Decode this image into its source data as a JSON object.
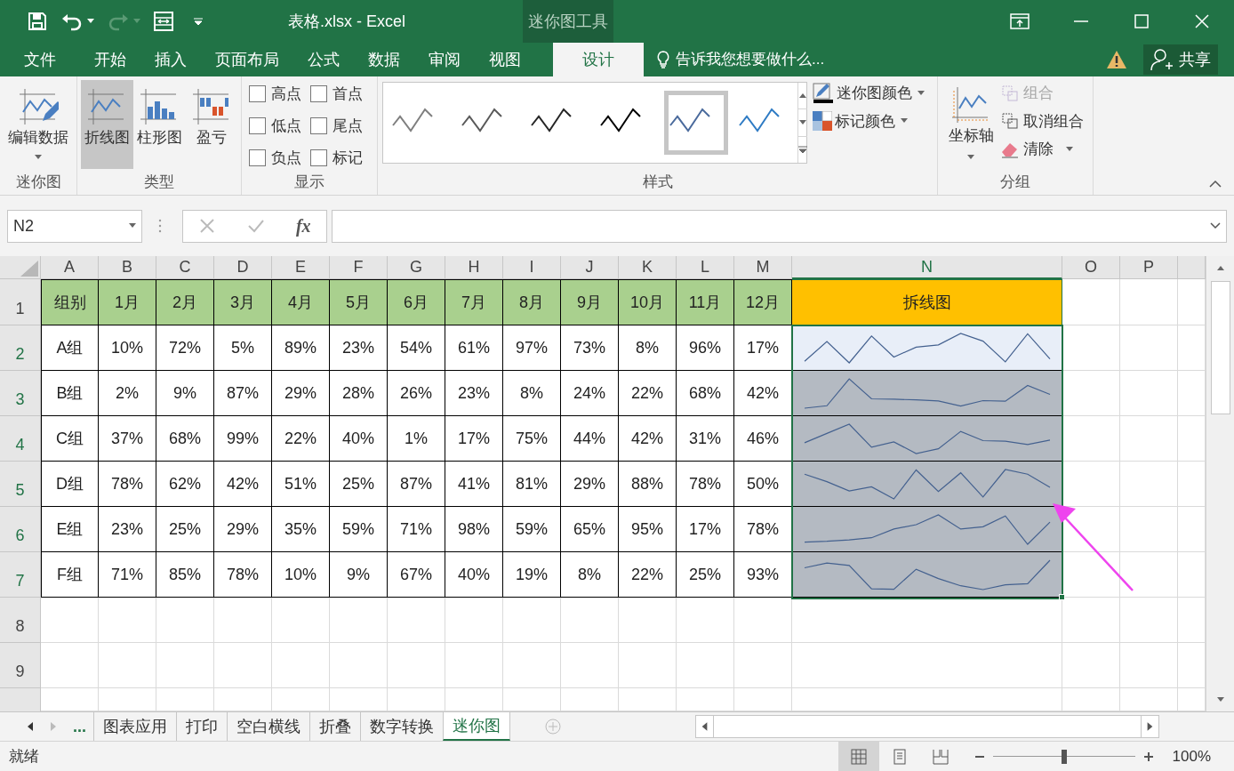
{
  "window": {
    "title": "表格.xlsx - Excel",
    "context_tab": "迷你图工具"
  },
  "ribbon_tabs": [
    {
      "label": "文件",
      "selected": false
    },
    {
      "label": "开始",
      "selected": false
    },
    {
      "label": "插入",
      "selected": false
    },
    {
      "label": "页面布局",
      "selected": false
    },
    {
      "label": "公式",
      "selected": false
    },
    {
      "label": "数据",
      "selected": false
    },
    {
      "label": "审阅",
      "selected": false
    },
    {
      "label": "视图",
      "selected": false
    },
    {
      "label": "设计",
      "selected": true
    }
  ],
  "tell_me": {
    "placeholder": "告诉我您想要做什么..."
  },
  "share": "共享",
  "ribbon": {
    "sparkline_group": {
      "label": "迷你图",
      "button": "编辑数据"
    },
    "type_group": {
      "label": "类型",
      "types": [
        {
          "label": "折线图",
          "kind": "line",
          "selected": true
        },
        {
          "label": "柱形图",
          "kind": "column",
          "selected": false
        },
        {
          "label": "盈亏",
          "kind": "winloss",
          "selected": false
        }
      ]
    },
    "show_group": {
      "label": "显示",
      "options": [
        {
          "label": "高点",
          "checked": false
        },
        {
          "label": "首点",
          "checked": false
        },
        {
          "label": "低点",
          "checked": false
        },
        {
          "label": "尾点",
          "checked": false
        },
        {
          "label": "负点",
          "checked": false
        },
        {
          "label": "标记",
          "checked": false
        }
      ]
    },
    "style_group": {
      "label": "样式",
      "styles": [
        {
          "color": "#7f7f7f",
          "selected": false
        },
        {
          "color": "#595959",
          "selected": false
        },
        {
          "color": "#262626",
          "selected": false
        },
        {
          "color": "#000000",
          "selected": false
        },
        {
          "color": "#4a6a9c",
          "selected": true
        },
        {
          "color": "#2e7bc4",
          "selected": false
        }
      ],
      "sparkline_color": "迷你图颜色",
      "marker_color": "标记颜色"
    },
    "group_group": {
      "label": "分组",
      "axis": "坐标轴",
      "group": {
        "label": "组合",
        "disabled": true
      },
      "ungroup": {
        "label": "取消组合",
        "disabled": false
      },
      "clear": "清除"
    }
  },
  "formula_bar": {
    "name_box": "N2",
    "fx": "fx"
  },
  "sheet": {
    "columns": [
      {
        "label": "A",
        "selected": false
      },
      {
        "label": "B",
        "selected": false
      },
      {
        "label": "C",
        "selected": false
      },
      {
        "label": "D",
        "selected": false
      },
      {
        "label": "E",
        "selected": false
      },
      {
        "label": "F",
        "selected": false
      },
      {
        "label": "G",
        "selected": false
      },
      {
        "label": "H",
        "selected": false
      },
      {
        "label": "I",
        "selected": false
      },
      {
        "label": "J",
        "selected": false
      },
      {
        "label": "K",
        "selected": false
      },
      {
        "label": "L",
        "selected": false
      },
      {
        "label": "M",
        "selected": false
      },
      {
        "label": "N",
        "selected": true
      },
      {
        "label": "O",
        "selected": false
      },
      {
        "label": "P",
        "selected": false
      }
    ],
    "header_row": {
      "number": "1",
      "selected": false,
      "cells": [
        "组别",
        "1月",
        "2月",
        "3月",
        "4月",
        "5月",
        "6月",
        "7月",
        "8月",
        "9月",
        "10月",
        "11月",
        "12月"
      ],
      "summary": "拆线图"
    },
    "rows": [
      {
        "number": "2",
        "selected": true,
        "active": true,
        "cells": [
          "A组",
          "10%",
          "72%",
          "5%",
          "89%",
          "23%",
          "54%",
          "61%",
          "97%",
          "73%",
          "8%",
          "96%",
          "17%"
        ]
      },
      {
        "number": "3",
        "selected": true,
        "active": false,
        "cells": [
          "B组",
          "2%",
          "9%",
          "87%",
          "29%",
          "28%",
          "26%",
          "23%",
          "8%",
          "24%",
          "22%",
          "68%",
          "42%"
        ]
      },
      {
        "number": "4",
        "selected": true,
        "active": false,
        "cells": [
          "C组",
          "37%",
          "68%",
          "99%",
          "22%",
          "40%",
          "1%",
          "17%",
          "75%",
          "44%",
          "42%",
          "31%",
          "46%"
        ]
      },
      {
        "number": "5",
        "selected": true,
        "active": false,
        "cells": [
          "D组",
          "78%",
          "62%",
          "42%",
          "51%",
          "25%",
          "87%",
          "41%",
          "81%",
          "29%",
          "88%",
          "78%",
          "50%"
        ]
      },
      {
        "number": "6",
        "selected": true,
        "active": false,
        "cells": [
          "E组",
          "23%",
          "25%",
          "29%",
          "35%",
          "59%",
          "71%",
          "98%",
          "59%",
          "65%",
          "95%",
          "17%",
          "78%"
        ]
      },
      {
        "number": "7",
        "selected": true,
        "active": false,
        "cells": [
          "F组",
          "71%",
          "85%",
          "78%",
          "10%",
          "9%",
          "67%",
          "40%",
          "19%",
          "8%",
          "22%",
          "25%",
          "93%"
        ]
      }
    ],
    "empty_rows": [
      "8",
      "9"
    ]
  },
  "sheet_tabs": {
    "more": "...",
    "tabs": [
      {
        "label": "图表应用",
        "selected": false
      },
      {
        "label": "打印",
        "selected": false
      },
      {
        "label": "空白横线",
        "selected": false
      },
      {
        "label": "折叠",
        "selected": false
      },
      {
        "label": "数字转换",
        "selected": false
      },
      {
        "label": "迷你图",
        "selected": true
      }
    ]
  },
  "status_bar": {
    "status": "就绪",
    "views": [
      {
        "kind": "normal",
        "selected": true
      },
      {
        "kind": "layout",
        "selected": false
      },
      {
        "kind": "break",
        "selected": false
      }
    ],
    "zoom": "100%",
    "zoom_slider": {
      "level": 0.5
    }
  }
}
